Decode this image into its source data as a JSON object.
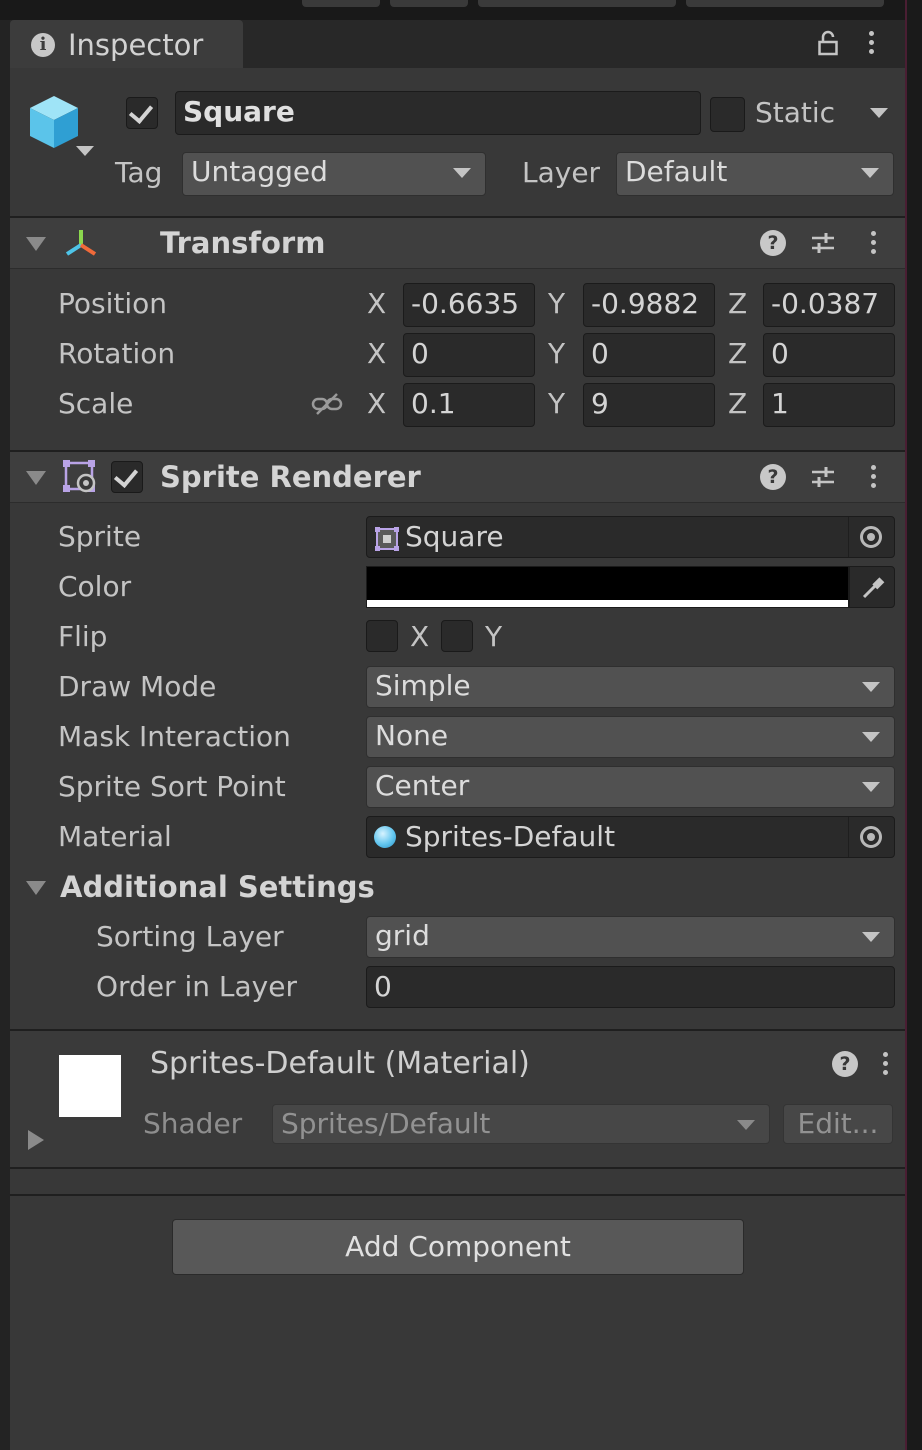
{
  "inspector_tab": {
    "label": "Inspector"
  },
  "object": {
    "name": "Square",
    "static_label": "Static",
    "tag_label": "Tag",
    "tag_value": "Untagged",
    "layer_label": "Layer",
    "layer_value": "Default"
  },
  "transform": {
    "title": "Transform",
    "rows": [
      {
        "label": "Position",
        "x": "-0.6635",
        "y": "-0.9882",
        "z": "-0.0387"
      },
      {
        "label": "Rotation",
        "x": "0",
        "y": "0",
        "z": "0"
      },
      {
        "label": "Scale",
        "x": "0.1",
        "y": "9",
        "z": "1"
      }
    ],
    "axis_x": "X",
    "axis_y": "Y",
    "axis_z": "Z"
  },
  "sprite_renderer": {
    "title": "Sprite Renderer",
    "sprite_label": "Sprite",
    "sprite_value": "Square",
    "color_label": "Color",
    "color_value": "#000000",
    "flip_label": "Flip",
    "flip_x": "X",
    "flip_y": "Y",
    "draw_mode_label": "Draw Mode",
    "draw_mode_value": "Simple",
    "mask_label": "Mask Interaction",
    "mask_value": "None",
    "sort_point_label": "Sprite Sort Point",
    "sort_point_value": "Center",
    "material_label": "Material",
    "material_value": "Sprites-Default",
    "additional_title": "Additional Settings",
    "sorting_layer_label": "Sorting Layer",
    "sorting_layer_value": "grid",
    "order_label": "Order in Layer",
    "order_value": "0"
  },
  "material": {
    "title": "Sprites-Default (Material)",
    "shader_label": "Shader",
    "shader_value": "Sprites/Default",
    "edit_label": "Edit..."
  },
  "add_component": {
    "label": "Add Component"
  }
}
